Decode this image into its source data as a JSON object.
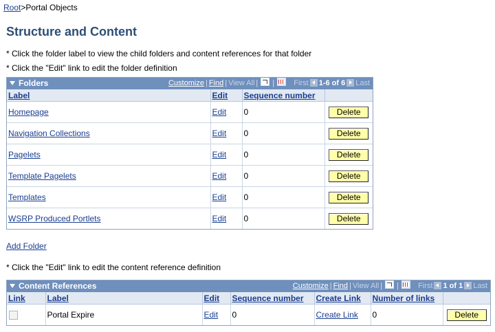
{
  "breadcrumb": {
    "root": "Root",
    "current": ">Portal Objects"
  },
  "page_title": "Structure and Content",
  "instructions": {
    "line1": "* Click the folder label to view the child folders and content references for that folder",
    "line2": "* Click the \"Edit\" link to edit the folder definition",
    "line3": "* Click the \"Edit\" link to edit the content reference definition"
  },
  "folders_grid": {
    "title": "Folders",
    "customize": "Customize",
    "find": "Find",
    "view_all": "View All",
    "first": "First",
    "count": "1-6 of 6",
    "last": "Last",
    "columns": {
      "label": "Label",
      "edit": "Edit",
      "seq": "Sequence number"
    },
    "rows": [
      {
        "label": "Homepage",
        "edit": "Edit",
        "seq": "0",
        "delete": "Delete"
      },
      {
        "label": "Navigation Collections",
        "edit": "Edit",
        "seq": "0",
        "delete": "Delete"
      },
      {
        "label": "Pagelets",
        "edit": "Edit",
        "seq": "0",
        "delete": "Delete"
      },
      {
        "label": "Template Pagelets",
        "edit": "Edit",
        "seq": "0",
        "delete": "Delete"
      },
      {
        "label": "Templates",
        "edit": "Edit",
        "seq": "0",
        "delete": "Delete"
      },
      {
        "label": "WSRP Produced Portlets",
        "edit": "Edit",
        "seq": "0",
        "delete": "Delete"
      }
    ]
  },
  "add_folder": "Add Folder",
  "content_grid": {
    "title": "Content References",
    "customize": "Customize",
    "find": "Find",
    "view_all": "View All",
    "first": "First",
    "count": "1 of 1",
    "last": "Last",
    "columns": {
      "link": "Link",
      "label": "Label",
      "edit": "Edit",
      "seq": "Sequence number",
      "create_link": "Create Link",
      "num_links": "Number of links"
    },
    "rows": [
      {
        "label": "Portal Expire",
        "edit": "Edit",
        "seq": "0",
        "create_link": "Create Link",
        "num_links": "0",
        "delete": "Delete"
      }
    ]
  }
}
